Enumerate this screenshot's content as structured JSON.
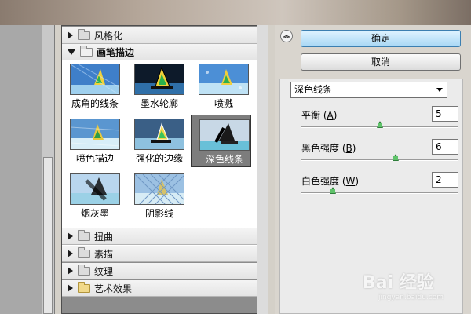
{
  "filter_gallery": {
    "categories_top": [
      {
        "label": "风格化",
        "expanded": false
      }
    ],
    "open_category": {
      "label": "画笔描边",
      "expanded": true
    },
    "filters": [
      {
        "label": "成角的线条",
        "selected": false
      },
      {
        "label": "墨水轮廓",
        "selected": false
      },
      {
        "label": "喷溅",
        "selected": false
      },
      {
        "label": "喷色描边",
        "selected": false
      },
      {
        "label": "强化的边缘",
        "selected": false
      },
      {
        "label": "深色线条",
        "selected": true
      },
      {
        "label": "烟灰墨",
        "selected": false
      },
      {
        "label": "阴影线",
        "selected": false
      }
    ],
    "categories_bottom": [
      {
        "label": "扭曲",
        "folder_color": "gray"
      },
      {
        "label": "素描",
        "folder_color": "gray"
      },
      {
        "label": "纹理",
        "folder_color": "gray"
      },
      {
        "label": "艺术效果",
        "folder_color": "yellow"
      }
    ]
  },
  "buttons": {
    "ok_label": "确定",
    "cancel_label": "取消",
    "collapse_icon": "chevron-double-up-icon"
  },
  "settings": {
    "selected_filter": "深色线条",
    "params": [
      {
        "label": "平衡",
        "shortcut": "A",
        "value": "5",
        "fraction": 0.5
      },
      {
        "label": "黑色强度",
        "shortcut": "B",
        "value": "6",
        "fraction": 0.6
      },
      {
        "label": "白色强度",
        "shortcut": "W",
        "value": "2",
        "fraction": 0.2
      }
    ]
  },
  "watermark": {
    "text": "Bai 经验",
    "url": "jingyan.baidu.com"
  },
  "colors": {
    "default_button": "#a9d8f5",
    "slider_knob": "#2e7d3a",
    "selected_thumb": "#7d7d7d"
  }
}
